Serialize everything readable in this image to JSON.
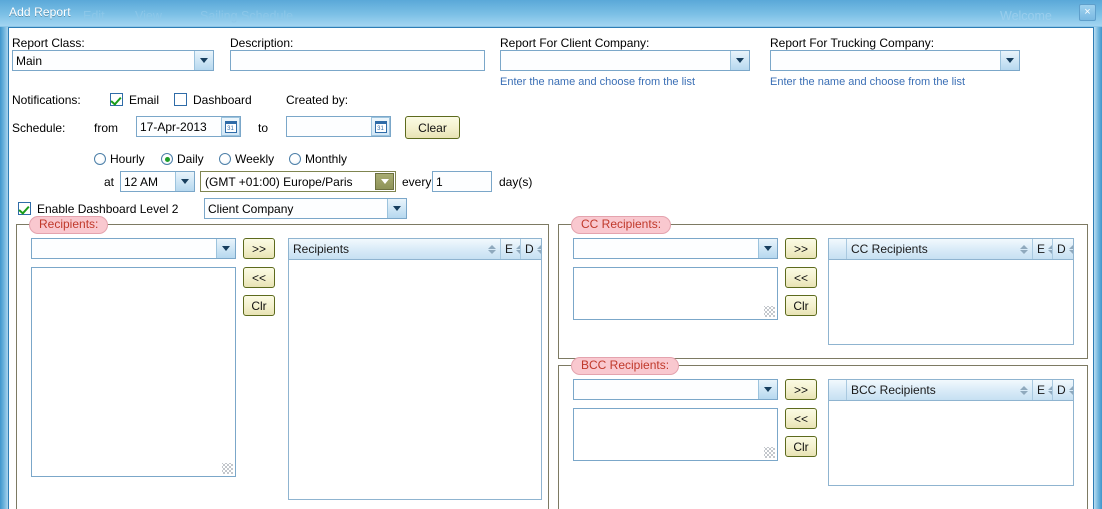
{
  "window": {
    "title": "Add Report",
    "close_label": "×",
    "ghost_menu": [
      "Edit",
      "View",
      "Sailing Schedule",
      "Welcome"
    ]
  },
  "form": {
    "report_class": {
      "label": "Report Class:",
      "value": "Main"
    },
    "description": {
      "label": "Description:",
      "value": "",
      "placeholder": ""
    },
    "client_company": {
      "label": "Report For Client Company:",
      "value": "",
      "hint": "Enter the name and choose from the list"
    },
    "trucking_company": {
      "label": "Report For Trucking Company:",
      "value": "",
      "hint": "Enter the name and choose from the list"
    },
    "notifications": {
      "label": "Notifications:",
      "email": {
        "label": "Email",
        "checked": true
      },
      "dashboard": {
        "label": "Dashboard",
        "checked": false
      }
    },
    "created_by": {
      "label": "Created by:"
    },
    "schedule": {
      "label": "Schedule:",
      "from_label": "from",
      "from_value": "17-Apr-2013",
      "to_label": "to",
      "to_value": "",
      "clear_label": "Clear"
    },
    "frequency": {
      "options": [
        {
          "label": "Hourly",
          "selected": false
        },
        {
          "label": "Daily",
          "selected": true
        },
        {
          "label": "Weekly",
          "selected": false
        },
        {
          "label": "Monthly",
          "selected": false
        }
      ]
    },
    "time_row": {
      "at_label": "at",
      "time_value": "12 AM",
      "timezone_value": "(GMT +01:00) Europe/Paris",
      "every_label": "every",
      "every_value": "1",
      "unit_label": "day(s)"
    },
    "dashboard_level2": {
      "label": "Enable Dashboard Level 2",
      "checked": true,
      "scope_value": "Client Company"
    }
  },
  "recipients": {
    "legend": "Recipients:",
    "picker_value": "",
    "source_list": [],
    "buttons": {
      "add": ">>",
      "remove": "<<",
      "clear": "Clr"
    },
    "grid": {
      "columns": [
        "Recipients",
        "E",
        "D"
      ],
      "rows": []
    }
  },
  "cc_recipients": {
    "legend": "CC Recipients:",
    "picker_value": "",
    "source_list": [],
    "buttons": {
      "add": ">>",
      "remove": "<<",
      "clear": "Clr"
    },
    "grid": {
      "columns": [
        "CC Recipients",
        "E",
        "D"
      ],
      "rows": []
    }
  },
  "bcc_recipients": {
    "legend": "BCC Recipients:",
    "picker_value": "",
    "source_list": [],
    "buttons": {
      "add": ">>",
      "remove": "<<",
      "clear": "Clr"
    },
    "grid": {
      "columns": [
        "BCC Recipients",
        "E",
        "D"
      ],
      "rows": []
    }
  },
  "colors": {
    "titlebar": "#7cc0e6",
    "panel_border": "#2e7db5",
    "legend_bg": "#f9c8cf",
    "legend_text": "#c0392b",
    "hint_text": "#3b6fb5",
    "button_border": "#5d6a1d",
    "check_green": "#1a9d1a",
    "grid_header": "#dbecf8"
  }
}
